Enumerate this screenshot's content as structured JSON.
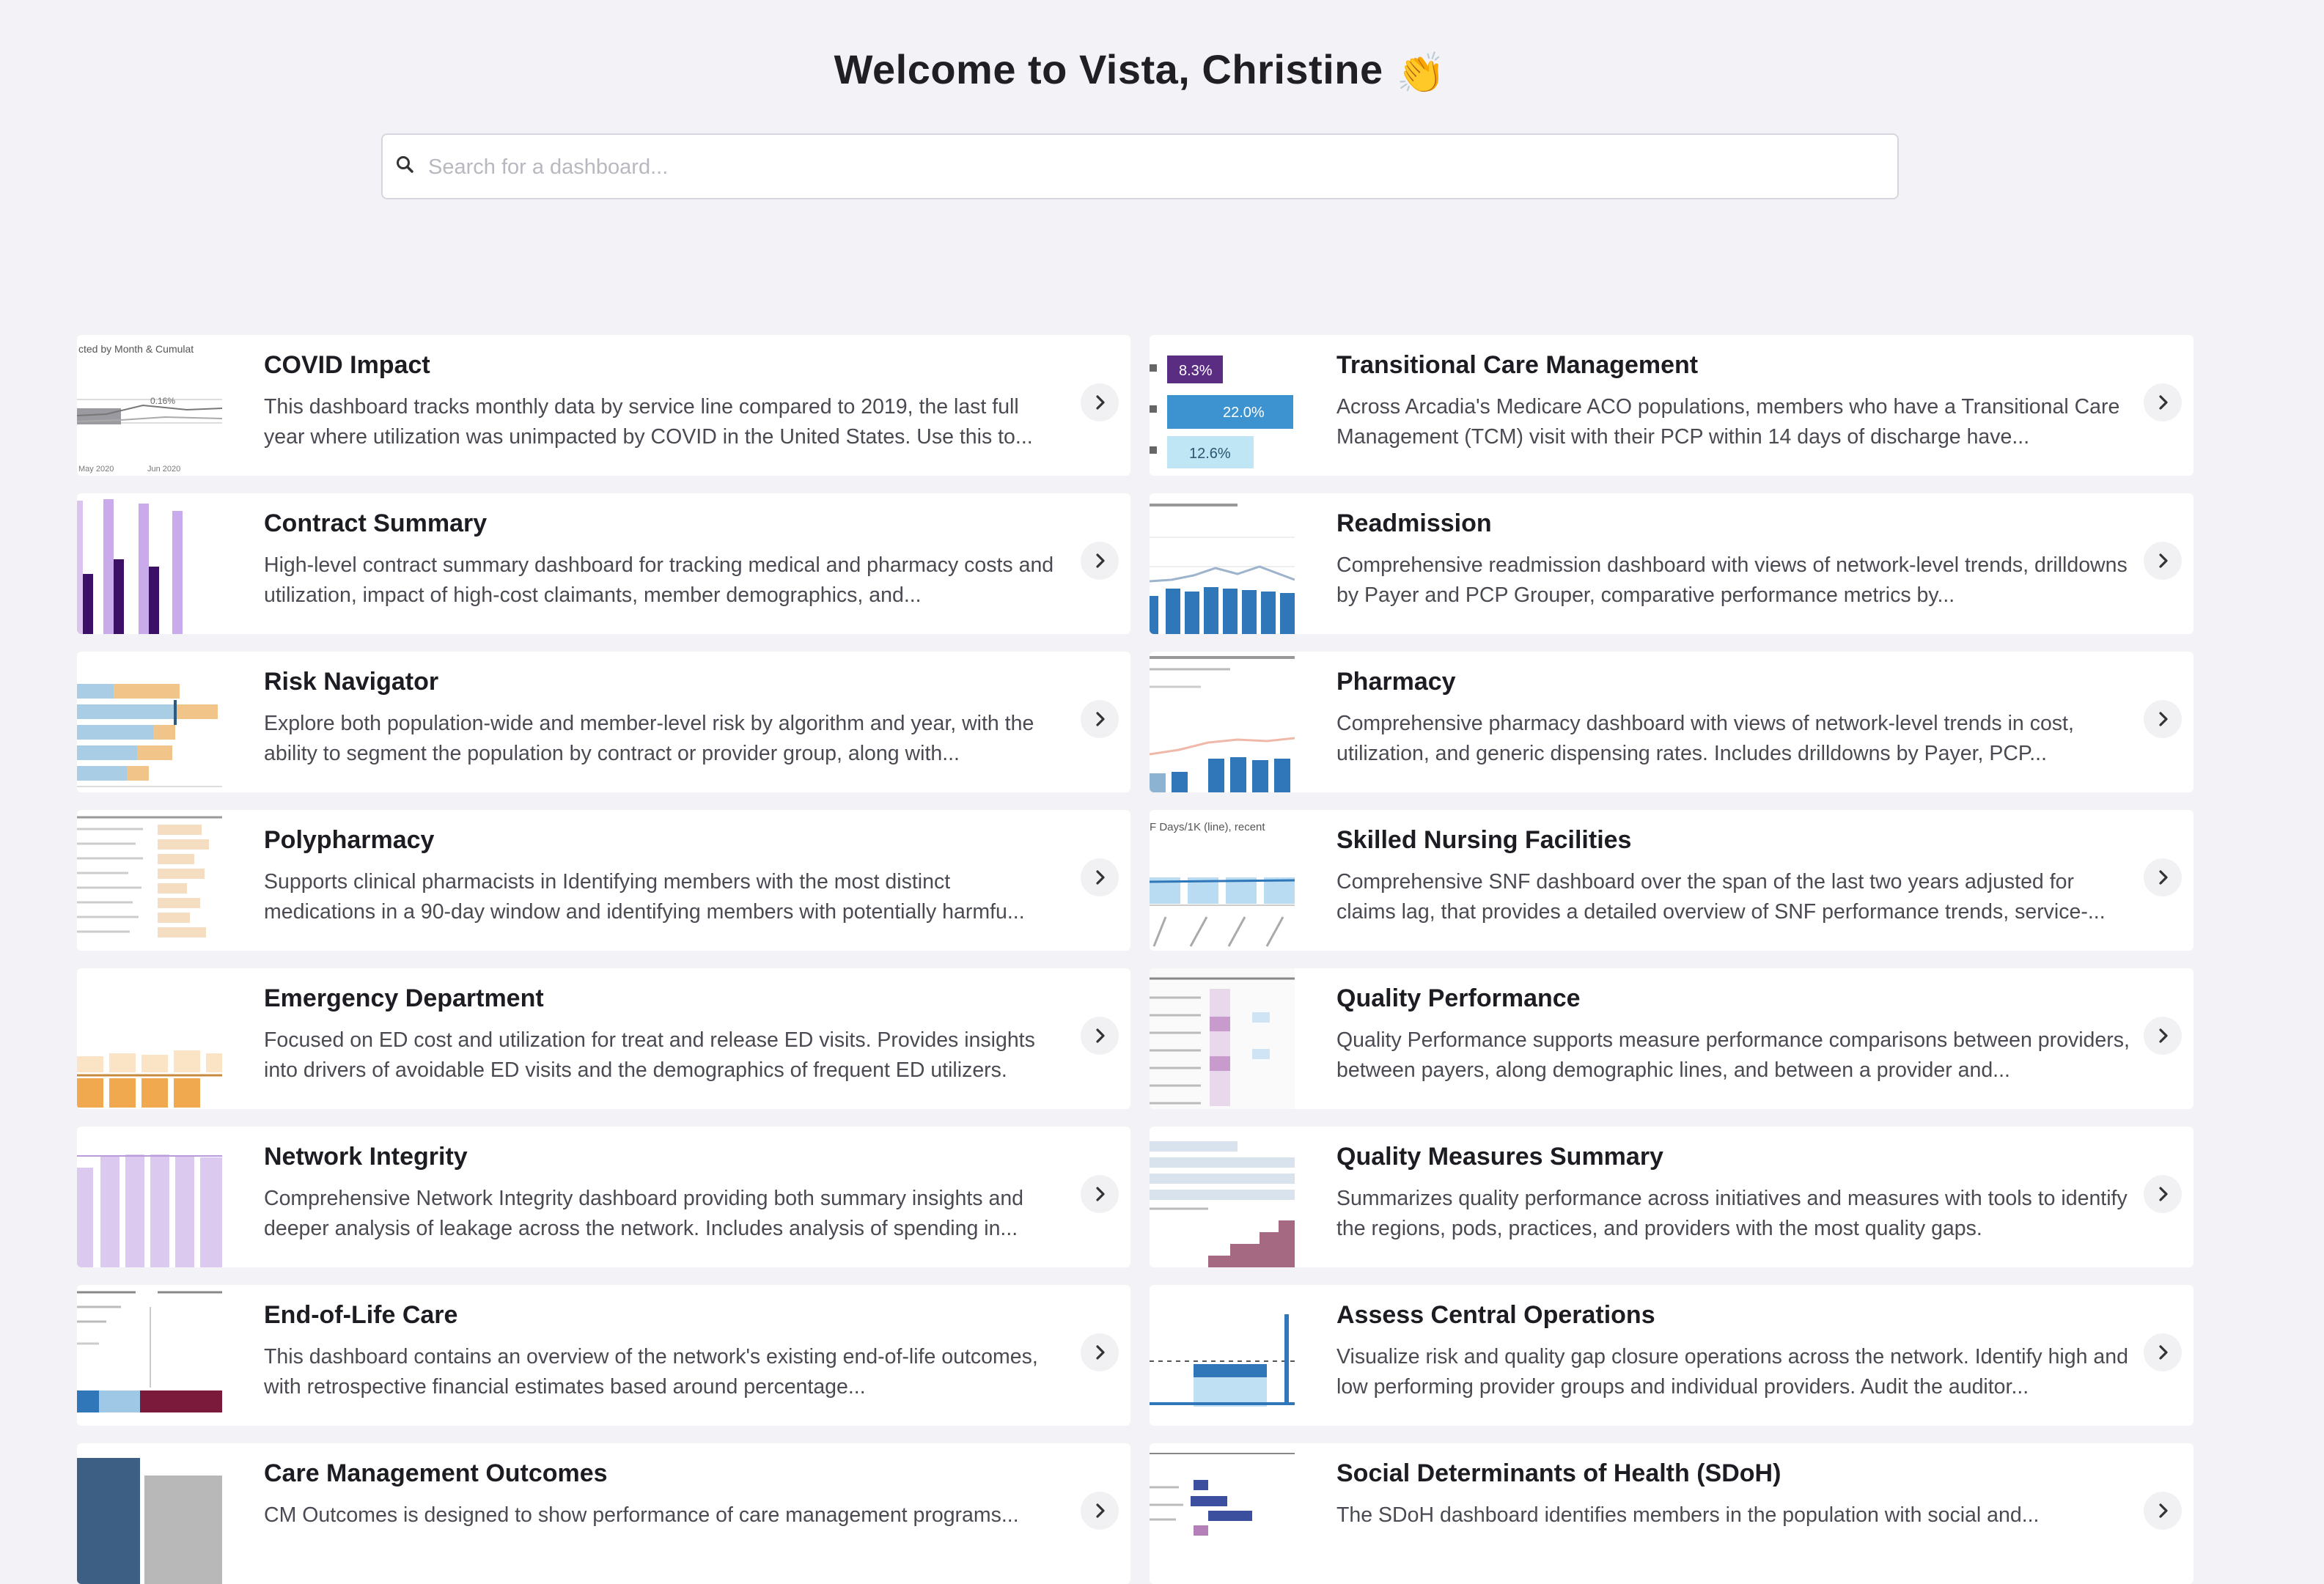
{
  "header": {
    "welcome": "Welcome to Vista, Christine",
    "wave_emoji": "👏"
  },
  "search": {
    "placeholder": "Search for a dashboard..."
  },
  "thumbnail_text": {
    "covid": {
      "title": "cted by Month & Cumulat",
      "val": "0.16%",
      "x1": "May 2020",
      "x2": "Jun 2020"
    },
    "tcm": {
      "p1": "8.3%",
      "p2": "22.0%",
      "p3": "12.6%"
    },
    "snf": {
      "title": "F Days/1K (line), recent"
    }
  },
  "dashboards": [
    {
      "title": "COVID Impact",
      "description": "This dashboard tracks monthly data by service line compared to 2019, the last full year where utilization was unimpacted by COVID in the United States. Use this to..."
    },
    {
      "title": "Transitional Care Management",
      "description": "Across Arcadia's Medicare ACO populations, members who have a Transitional Care Management (TCM) visit with their PCP within 14 days of discharge have..."
    },
    {
      "title": "Contract Summary",
      "description": "High-level contract summary dashboard for tracking medical and pharmacy costs and utilization, impact of high-cost claimants, member demographics, and..."
    },
    {
      "title": "Readmission",
      "description": "Comprehensive readmission dashboard with views of network-level trends, drilldowns by Payer and PCP Grouper, comparative performance metrics by..."
    },
    {
      "title": "Risk Navigator",
      "description": "Explore both population-wide and member-level risk by algorithm and year, with the ability to segment the population by contract or provider group, along with..."
    },
    {
      "title": "Pharmacy",
      "description": "Comprehensive pharmacy dashboard with views of network-level trends in cost, utilization, and generic dispensing rates. Includes drilldowns by Payer, PCP..."
    },
    {
      "title": "Polypharmacy",
      "description": "Supports clinical pharmacists in Identifying members with the most distinct medications in a 90-day window and identifying members with potentially harmfu..."
    },
    {
      "title": "Skilled Nursing Facilities",
      "description": "Comprehensive SNF dashboard over the span of the last two years adjusted for claims lag, that provides a detailed overview of SNF performance trends, service-..."
    },
    {
      "title": "Emergency Department",
      "description": "Focused on ED cost and utilization for treat and release ED visits. Provides insights into drivers of avoidable ED visits and the demographics of frequent ED utilizers."
    },
    {
      "title": "Quality Performance",
      "description": "Quality Performance supports measure performance comparisons between providers, between payers, along demographic lines, and between a provider and..."
    },
    {
      "title": "Network Integrity",
      "description": "Comprehensive Network Integrity dashboard providing both summary insights and deeper analysis of leakage across the network. Includes analysis of spending in..."
    },
    {
      "title": "Quality Measures Summary",
      "description": "Summarizes quality performance across initiatives and measures with tools to identify the regions, pods, practices, and providers with the most quality gaps."
    },
    {
      "title": "End-of-Life Care",
      "description": "This dashboard contains an overview of the network's existing end-of-life outcomes, with retrospective financial estimates based around percentage..."
    },
    {
      "title": "Assess Central Operations",
      "description": "Visualize risk and quality gap closure operations across the network. Identify high and low performing provider groups and individual providers. Audit the auditor..."
    },
    {
      "title": "Care Management Outcomes",
      "description": "CM Outcomes is designed to show performance of care management programs..."
    },
    {
      "title": "Social Determinants of Health (SDoH)",
      "description": "The SDoH dashboard identifies members in the population with social and..."
    }
  ]
}
